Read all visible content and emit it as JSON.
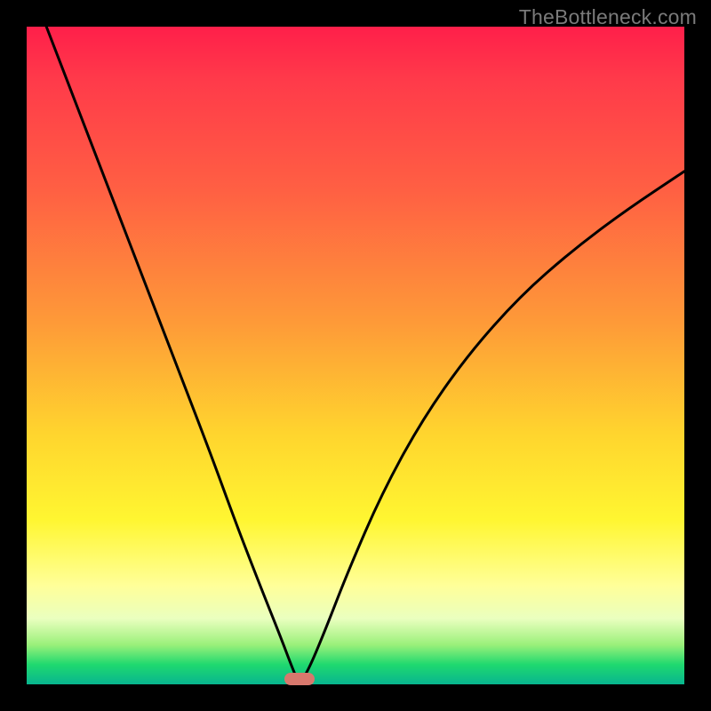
{
  "watermark": "TheBottleneck.com",
  "marker": {
    "x_frac": 0.415,
    "y_at_bottom": true
  },
  "colors": {
    "curve_stroke": "#000000",
    "marker_fill": "#d8786d",
    "frame_bg": "#000000"
  },
  "chart_data": {
    "type": "line",
    "title": "",
    "xlabel": "",
    "ylabel": "",
    "xlim": [
      0,
      1
    ],
    "ylim": [
      0,
      1
    ],
    "note": "Abstract bottleneck curve on a red→green vertical gradient. Minimum (optimum) near x≈0.415. No axes, ticks, or numeric labels are shown.",
    "background_gradient_stops": [
      {
        "pos": 0.0,
        "color": "#ff1f4a"
      },
      {
        "pos": 0.08,
        "color": "#ff3a4a"
      },
      {
        "pos": 0.25,
        "color": "#ff6043"
      },
      {
        "pos": 0.45,
        "color": "#fe9a38"
      },
      {
        "pos": 0.62,
        "color": "#ffd52e"
      },
      {
        "pos": 0.75,
        "color": "#fff631"
      },
      {
        "pos": 0.85,
        "color": "#ffff99"
      },
      {
        "pos": 0.9,
        "color": "#eaffbf"
      },
      {
        "pos": 0.94,
        "color": "#9af07a"
      },
      {
        "pos": 0.97,
        "color": "#1fd96f"
      },
      {
        "pos": 1.0,
        "color": "#08b58f"
      }
    ],
    "series": [
      {
        "name": "bottleneck-curve",
        "x": [
          0.03,
          0.08,
          0.13,
          0.18,
          0.23,
          0.28,
          0.32,
          0.355,
          0.385,
          0.405,
          0.415,
          0.43,
          0.455,
          0.49,
          0.54,
          0.6,
          0.67,
          0.75,
          0.83,
          0.91,
          1.0
        ],
        "y": [
          1.0,
          0.87,
          0.74,
          0.61,
          0.48,
          0.35,
          0.24,
          0.15,
          0.075,
          0.022,
          0.0,
          0.025,
          0.085,
          0.175,
          0.29,
          0.4,
          0.5,
          0.59,
          0.66,
          0.72,
          0.78
        ]
      }
    ]
  }
}
